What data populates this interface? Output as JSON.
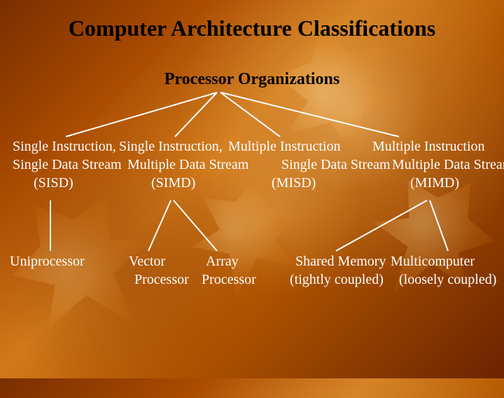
{
  "title": "Computer Architecture Classifications",
  "subtitle": "Processor Organizations",
  "row1": {
    "a": "Single Instruction,",
    "b": "Single Instruction,",
    "c": "Multiple Instruction",
    "d": "Multiple Instruction"
  },
  "row2": {
    "a": "Single Data Stream",
    "b": "Multiple Data Stream",
    "c": "Single Data Stream",
    "d": "Multiple Data Stream"
  },
  "row3": {
    "a": "(SISD)",
    "b": "(SIMD)",
    "c": "(MISD)",
    "d": "(MIMD)"
  },
  "leaf": {
    "a1": "Uniprocessor",
    "b1": "Vector",
    "b1b": "Processor",
    "b2": "Array",
    "b2b": "Processor",
    "d1": "Shared Memory",
    "d1b": "(tightly coupled)",
    "d2": "Multicomputer",
    "d2b": "(loosely coupled)"
  }
}
